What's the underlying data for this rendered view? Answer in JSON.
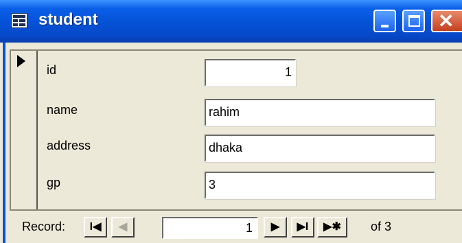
{
  "window": {
    "title": "student"
  },
  "icons": {
    "app": "form-icon",
    "minimize": "minimize-icon",
    "maximize": "maximize-icon",
    "close": "close-icon",
    "selector": "record-selector-arrow-icon"
  },
  "fields": {
    "id": {
      "label": "id",
      "value": "1"
    },
    "name": {
      "label": "name",
      "value": "rahim"
    },
    "address": {
      "label": "address",
      "value": "dhaka"
    },
    "gp": {
      "label": "gp",
      "value": "3"
    }
  },
  "navigator": {
    "label": "Record:",
    "first_glyph": "I◀",
    "prev_glyph": "◀",
    "current": "1",
    "next_glyph": "▶",
    "last_glyph": "▶I",
    "new_glyph": "▶✱",
    "total_text": "of 3"
  },
  "colors": {
    "titlebar": "#0553d8",
    "form_bg": "#ece9d8",
    "close_button": "#c4401f"
  }
}
